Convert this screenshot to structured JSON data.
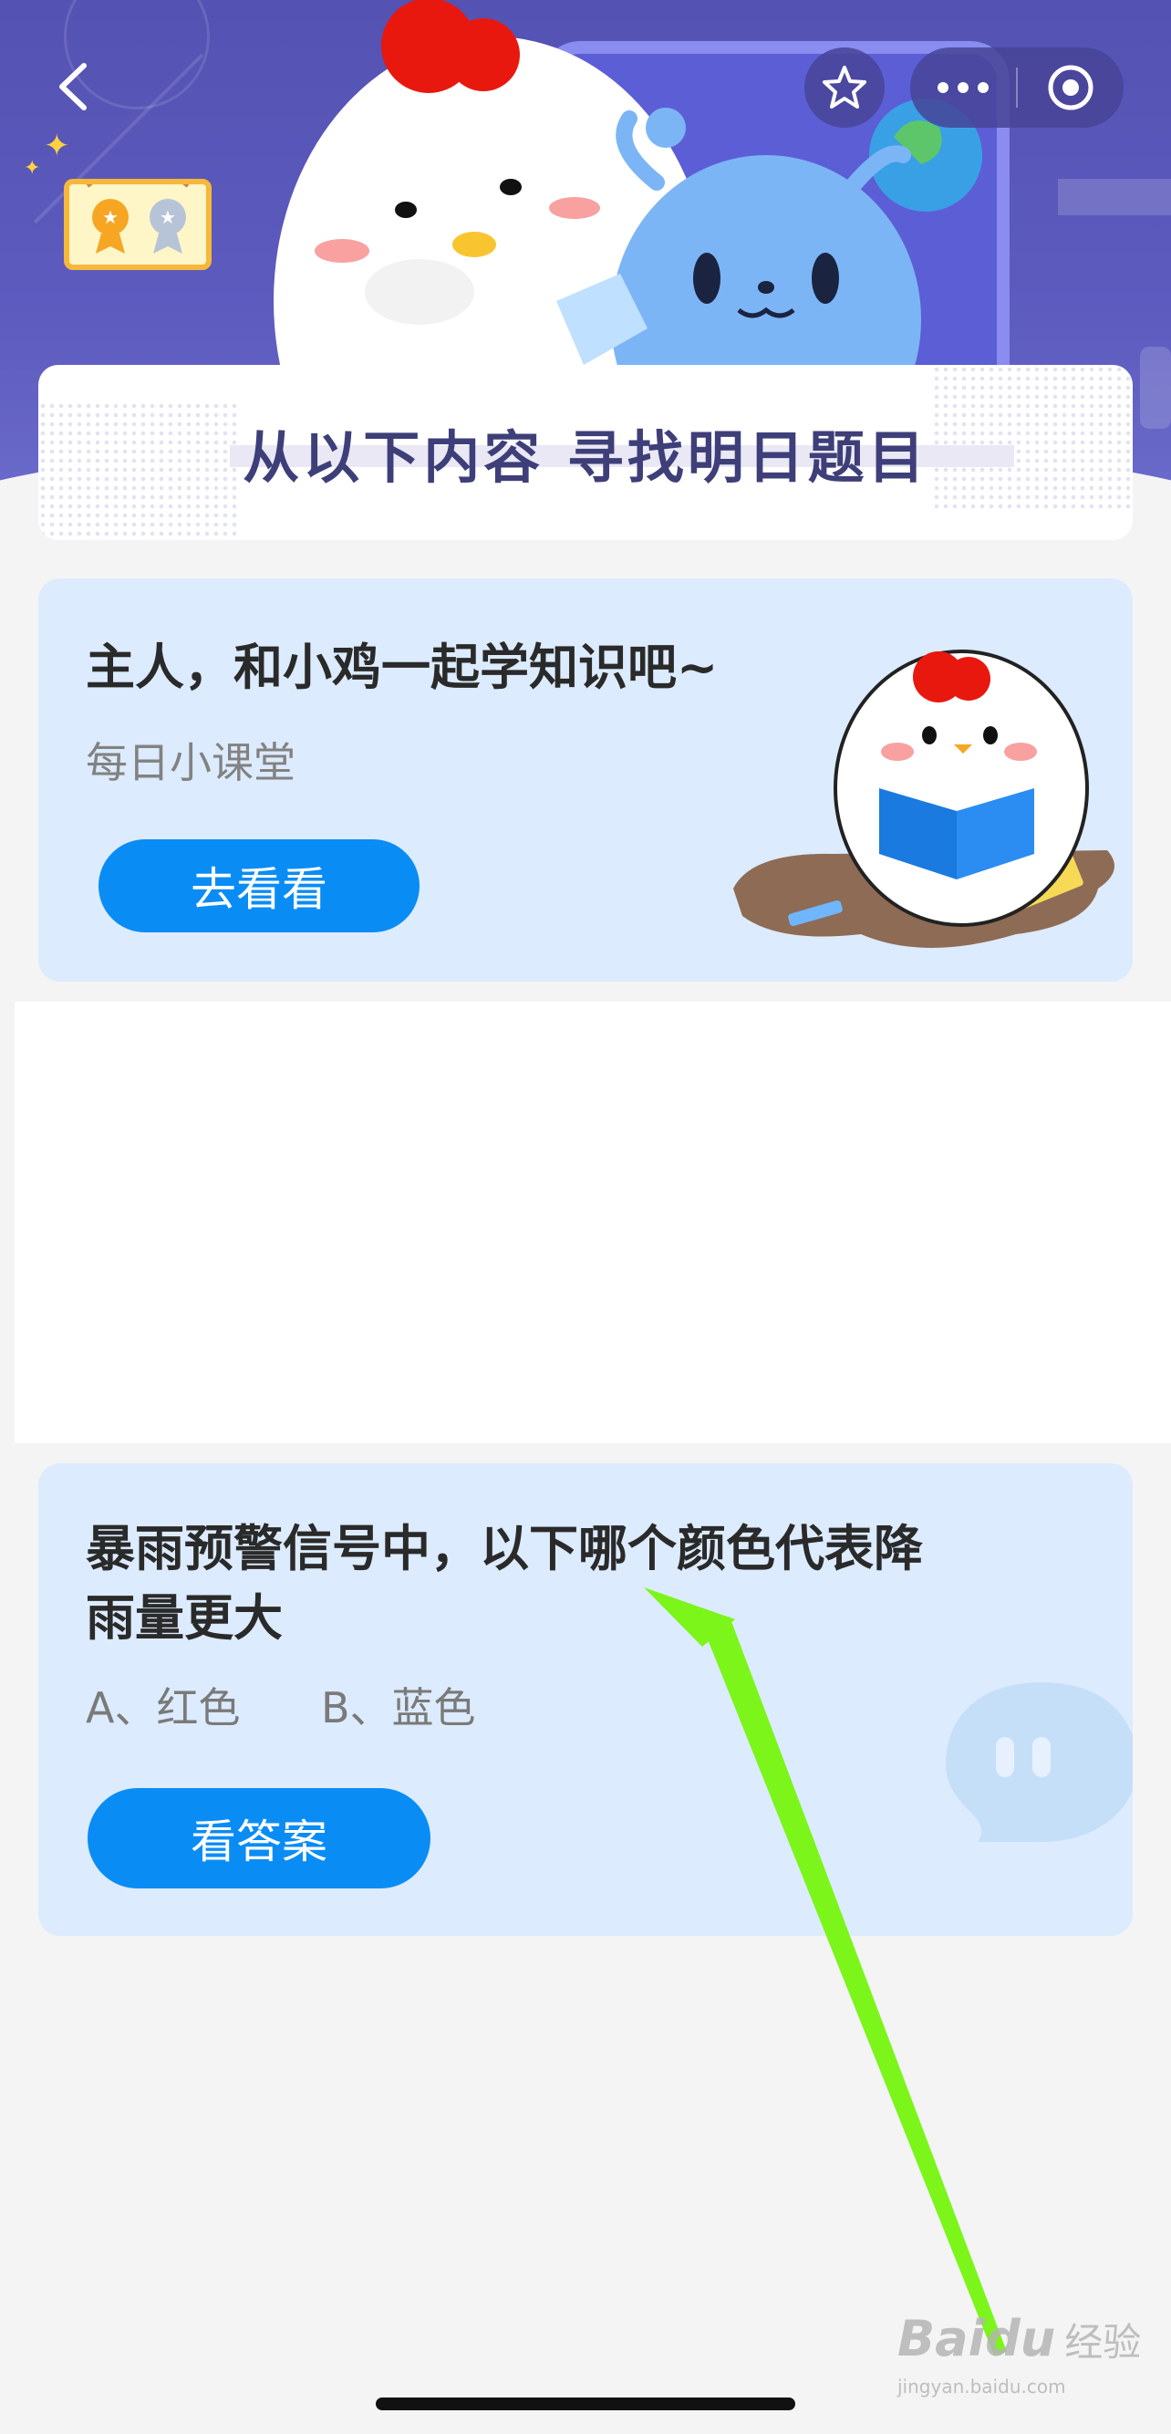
{
  "nav": {
    "back_icon": "chevron-left-icon",
    "favorite_icon": "star-icon",
    "more_icon": "more-dots-icon",
    "close_icon": "target-circle-icon"
  },
  "banner": {
    "title": "从以下内容  寻找明日题目"
  },
  "lesson_card": {
    "title": "主人，和小鸡一起学知识吧~",
    "subtitle": "每日小课堂",
    "button_label": "去看看"
  },
  "question_card": {
    "question_line1": "暴雨预警信号中，以下哪个颜色代表降",
    "question_line2": "雨量更大",
    "option_a": "A、红色",
    "option_b": "B、蓝色",
    "button_label": "看答案"
  },
  "watermark": {
    "brand": "Baidu",
    "suffix": "经验",
    "url": "jingyan.baidu.com"
  },
  "colors": {
    "header_bg": "#5d5bbe",
    "card_bg": "#dcebfd",
    "button_blue": "#0a8cf5",
    "title_text": "#3e3f79",
    "arrow_green": "#7cf51a"
  }
}
